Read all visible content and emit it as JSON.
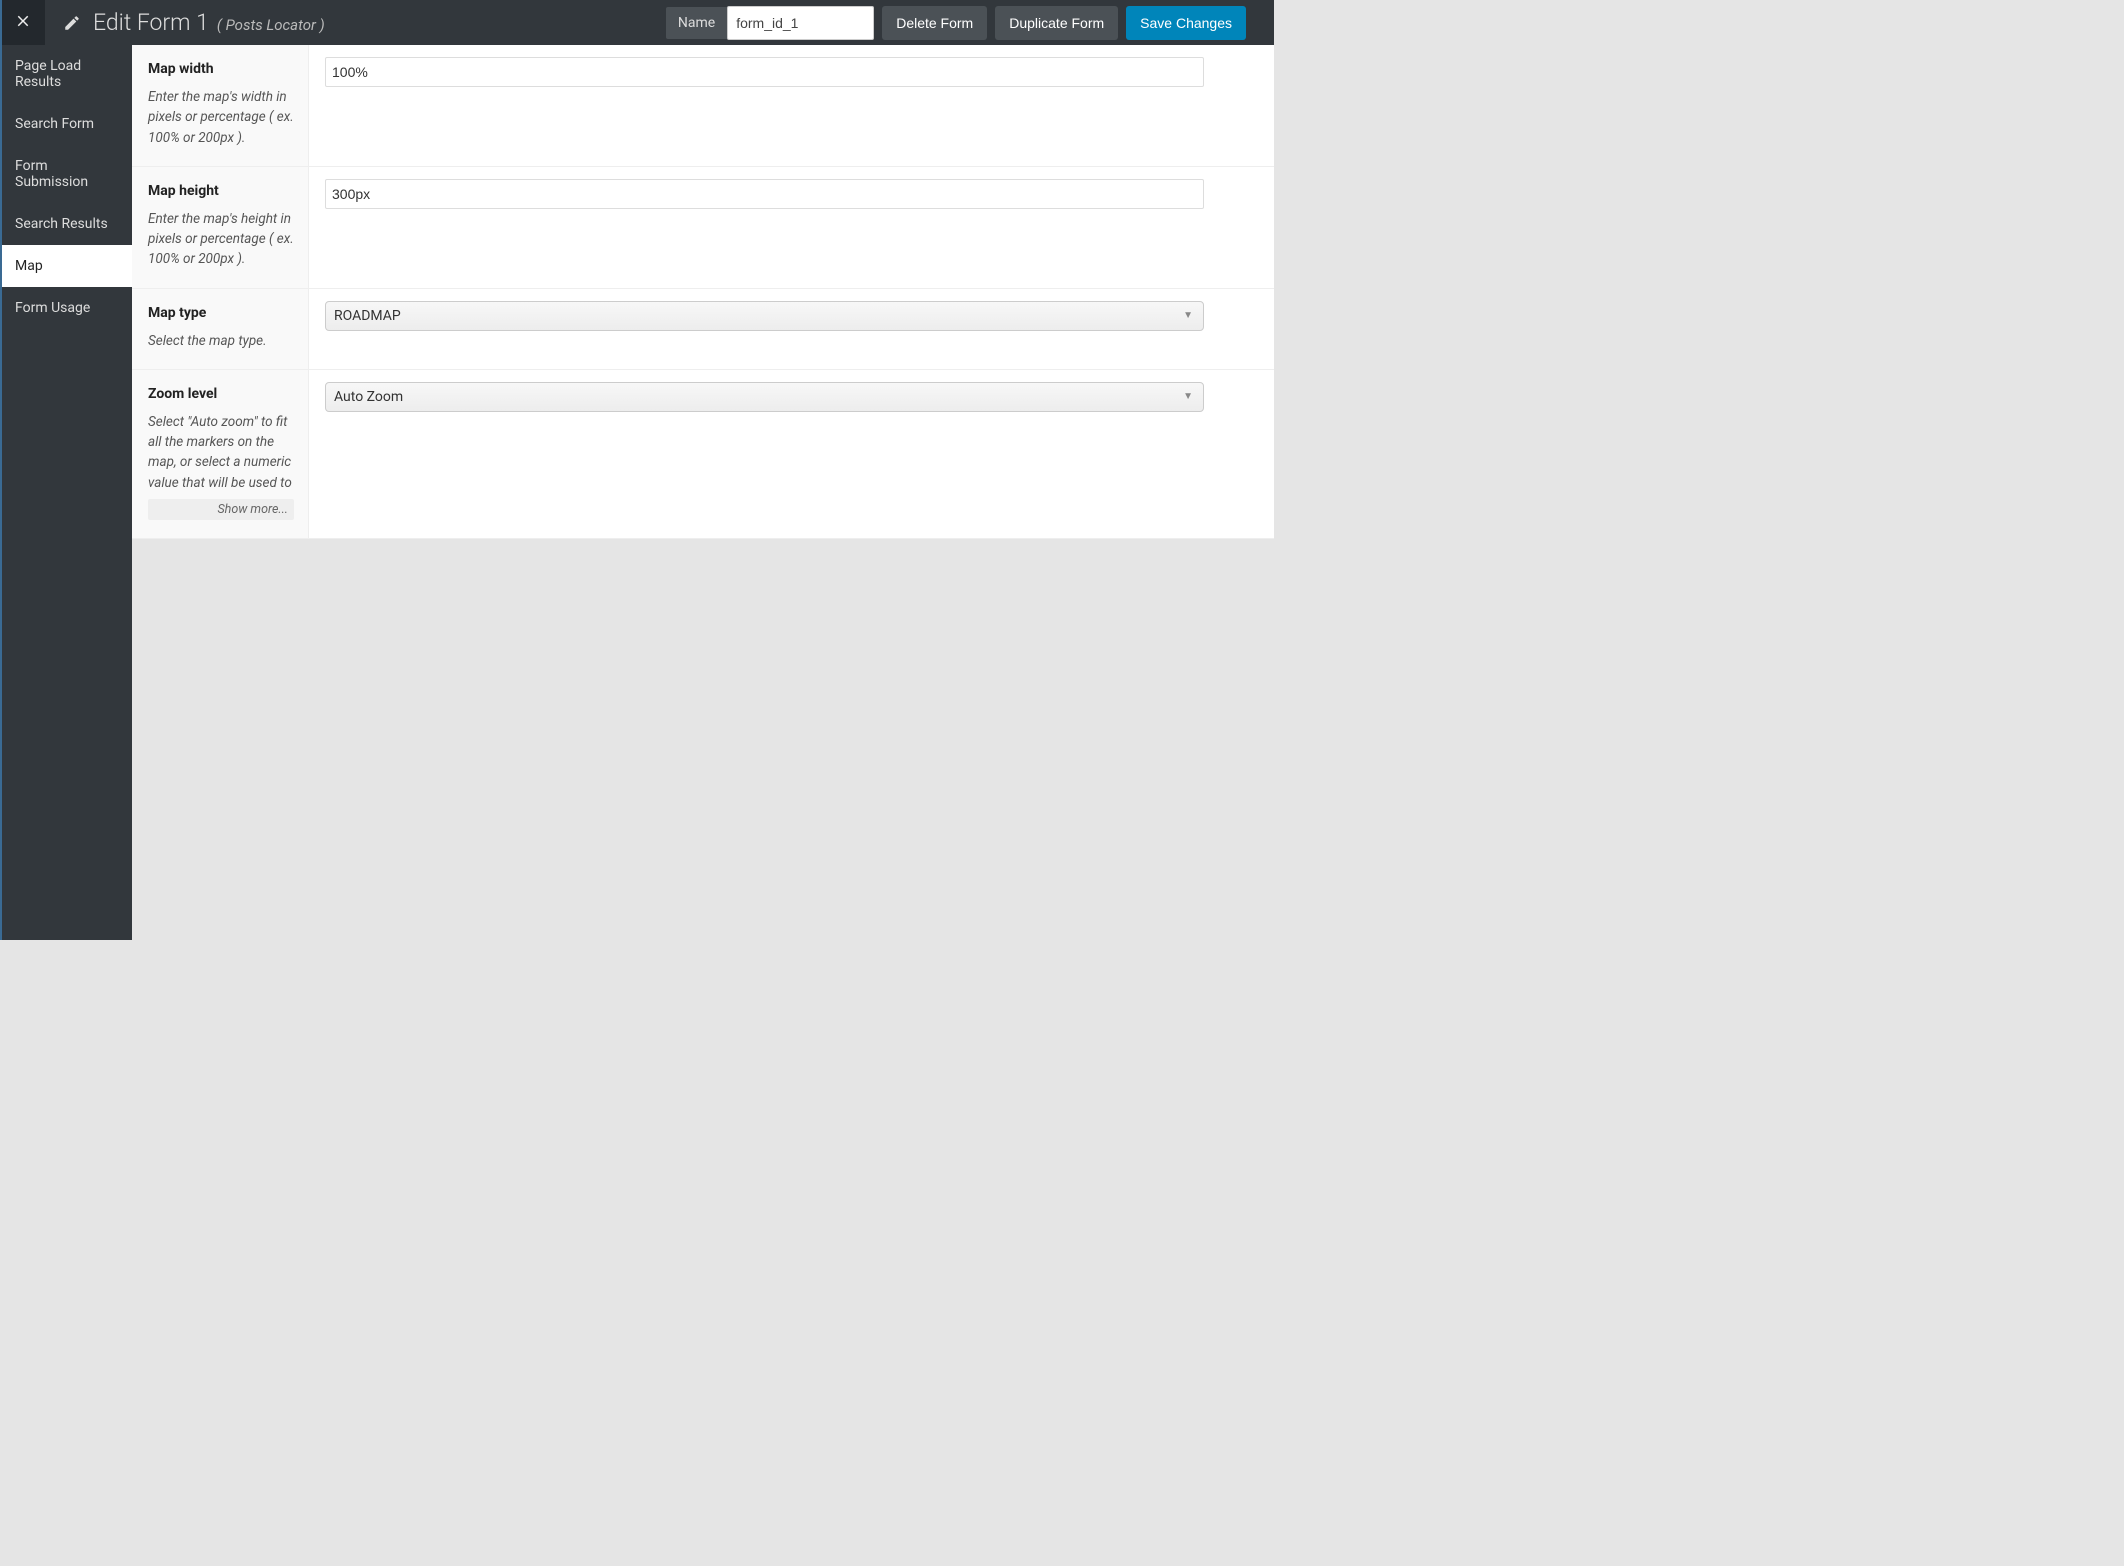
{
  "header": {
    "title": "Edit Form 1",
    "subtitle": "( Posts Locator )",
    "name_label": "Name",
    "name_value": "form_id_1",
    "delete_label": "Delete Form",
    "duplicate_label": "Duplicate Form",
    "save_label": "Save Changes"
  },
  "sidebar": {
    "items": [
      {
        "label": "Page Load Results",
        "active": false
      },
      {
        "label": "Search Form",
        "active": false
      },
      {
        "label": "Form Submission",
        "active": false
      },
      {
        "label": "Search Results",
        "active": false
      },
      {
        "label": "Map",
        "active": true
      },
      {
        "label": "Form Usage",
        "active": false
      }
    ]
  },
  "rows": [
    {
      "key": "map_width",
      "label": "Map width",
      "desc": "Enter the map's width in pixels or percentage ( ex. 100% or 200px ).",
      "type": "text",
      "value": "100%"
    },
    {
      "key": "map_height",
      "label": "Map height",
      "desc": "Enter the map's height in pixels or percentage ( ex. 100% or 200px ).",
      "type": "text",
      "value": "300px"
    },
    {
      "key": "map_type",
      "label": "Map type",
      "desc": "Select the map type.",
      "type": "select",
      "value": "ROADMAP"
    },
    {
      "key": "zoom_level",
      "label": "Zoom level",
      "desc": "Select \"Auto zoom\" to fit all the markers on the map, or select a numeric value that will be used to",
      "type": "select",
      "value": "Auto Zoom",
      "show_more": "Show more..."
    }
  ]
}
